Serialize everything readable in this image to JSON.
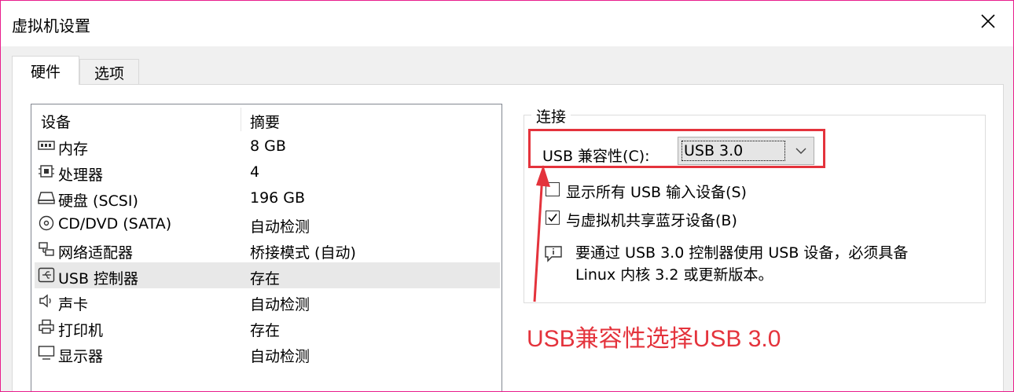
{
  "window": {
    "title": "虚拟机设置"
  },
  "tabs": [
    {
      "label": "硬件"
    },
    {
      "label": "选项"
    }
  ],
  "device_list": {
    "columns": [
      "设备",
      "摘要"
    ],
    "rows": [
      {
        "icon": "memory-icon",
        "name": "内存",
        "summary": "8 GB"
      },
      {
        "icon": "processor-icon",
        "name": "处理器",
        "summary": "4"
      },
      {
        "icon": "harddisk-icon",
        "name": "硬盘 (SCSI)",
        "summary": "196 GB"
      },
      {
        "icon": "cd-dvd-icon",
        "name": "CD/DVD (SATA)",
        "summary": "自动检测"
      },
      {
        "icon": "network-icon",
        "name": "网络适配器",
        "summary": "桥接模式 (自动)"
      },
      {
        "icon": "usb-icon",
        "name": "USB 控制器",
        "summary": "存在",
        "selected": true
      },
      {
        "icon": "sound-icon",
        "name": "声卡",
        "summary": "自动检测"
      },
      {
        "icon": "printer-icon",
        "name": "打印机",
        "summary": "存在"
      },
      {
        "icon": "display-icon",
        "name": "显示器",
        "summary": "自动检测"
      }
    ]
  },
  "connection": {
    "group_title": "连接",
    "compat_label": "USB 兼容性(C):",
    "compat_value": "USB 3.0",
    "show_all_input": {
      "label": "显示所有 USB 输入设备(S)",
      "checked": false
    },
    "share_bluetooth": {
      "label": "与虚拟机共享蓝牙设备(B)",
      "checked": true
    },
    "info_line1": "要通过 USB 3.0 控制器使用 USB 设备，必须具备",
    "info_line2": "Linux 内核 3.2 或更新版本。"
  },
  "annotation": {
    "text": "USB兼容性选择USB 3.0",
    "color": "#e4333c"
  },
  "colors": {
    "accent_red": "#e4333c",
    "window_border": "#e81e8c",
    "selection": "#e8e8e8"
  }
}
